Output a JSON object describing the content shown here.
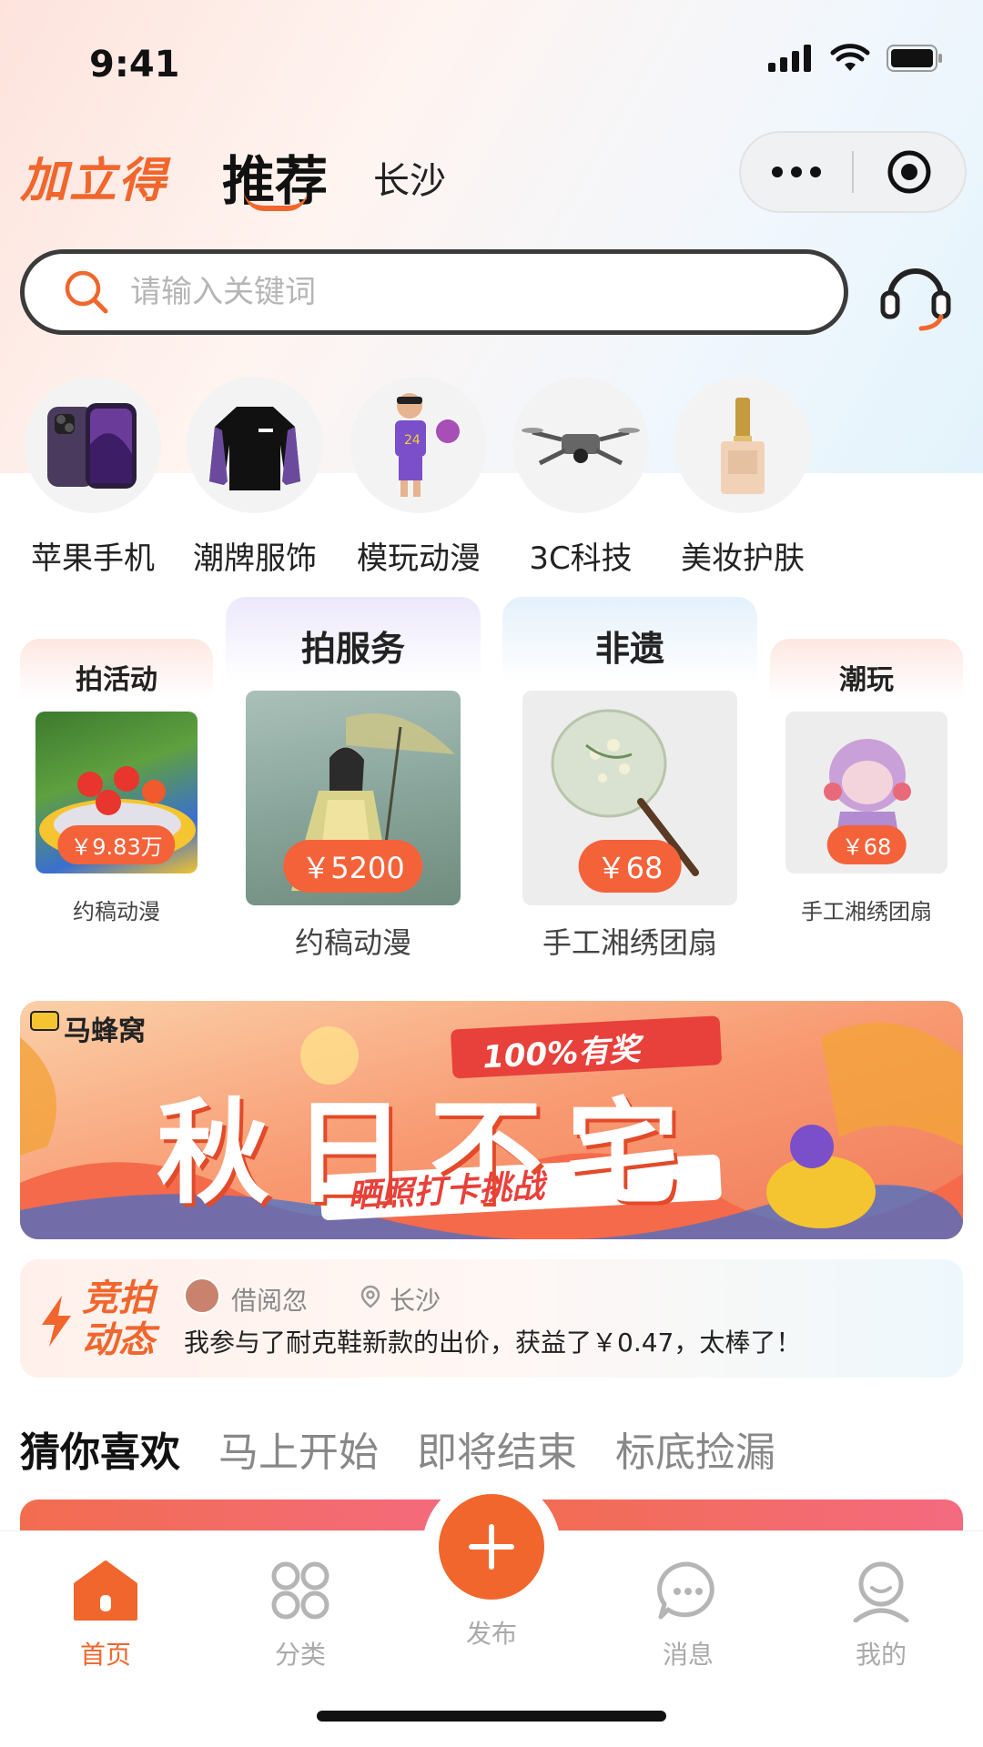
{
  "status_bar": {
    "time": "9:41"
  },
  "header": {
    "brand": "加立得",
    "active_tab": "推荐",
    "city": "长沙"
  },
  "search": {
    "placeholder": "请输入关键词"
  },
  "categories": [
    {
      "label": "苹果手机",
      "icon": "phone-icon"
    },
    {
      "label": "潮牌服饰",
      "icon": "sweater-icon"
    },
    {
      "label": "模玩动漫",
      "icon": "figure-icon"
    },
    {
      "label": "3C科技",
      "icon": "drone-icon"
    },
    {
      "label": "美妆护肤",
      "icon": "cosmetic-bottle-icon"
    }
  ],
  "features": [
    {
      "title": "拍活动",
      "price": "￥9.83万",
      "subtitle": "约稿动漫"
    },
    {
      "title": "拍服务",
      "price": "￥5200",
      "subtitle": "约稿动漫"
    },
    {
      "title": "非遗",
      "price": "￥68",
      "subtitle": "手工湘绣团扇"
    },
    {
      "title": "潮玩",
      "price": "￥68",
      "subtitle": "手工湘绣团扇"
    }
  ],
  "banner": {
    "brand": "马蜂窝",
    "tag": "100%有奖",
    "headline": "秋日不宅",
    "subline": "晒照打卡挑战"
  },
  "auction_feed": {
    "label_line1": "竞拍",
    "label_line2": "动态",
    "user": "借阅忽",
    "location": "长沙",
    "message": "我参与了耐克鞋新款的出价，获益了￥0.47，太棒了！"
  },
  "guess_tabs": [
    "猜你喜欢",
    "马上开始",
    "即将结束",
    "标底捡漏"
  ],
  "tabbar": {
    "home": "首页",
    "category": "分类",
    "publish": "发布",
    "messages": "消息",
    "mine": "我的"
  },
  "colors": {
    "accent": "#f0662d",
    "price_badge": "#f4623a",
    "inactive": "#aaaaaa"
  }
}
